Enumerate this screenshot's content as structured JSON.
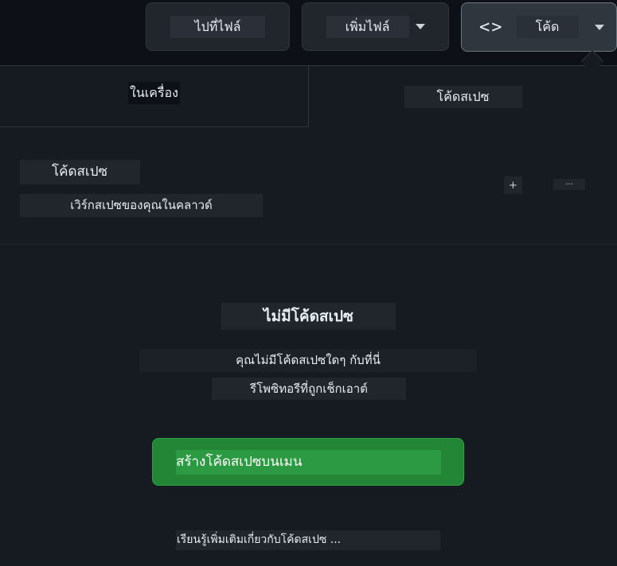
{
  "toolbar": {
    "goto_file_label": "ไปที่ไฟล์",
    "add_file_label": "เพิ่มไฟล์",
    "code_label": "โค้ด",
    "code_icon_glyph": "<>"
  },
  "panel": {
    "tabs": [
      {
        "label": "ในเครื่อง"
      },
      {
        "label": "โค้ดสเปซ"
      }
    ],
    "codespaces": {
      "title": "โค้ดสเปซ",
      "subtitle": "เวิร์กสเปซของคุณในคลาวด์",
      "add_glyph": "+",
      "more_glyph": "..."
    },
    "empty": {
      "title": "ไม่มีโค้ดสเปซ",
      "line1": "คุณไม่มีโค้ดสเปซใดๆ กับที่นี่",
      "line2": "รีโพซิทอรีที่ถูกเช็กเอาต์"
    },
    "create_label": "สร้างโค้ดสเปซบนเมน",
    "learn_more": "เรียนรู้เพิ่มเติมเกี่ยวกับโค้ดสเปซ ..."
  },
  "colors": {
    "background": "#0d1117",
    "panel": "#161b22",
    "button": "#21262d",
    "primary": "#238636"
  }
}
